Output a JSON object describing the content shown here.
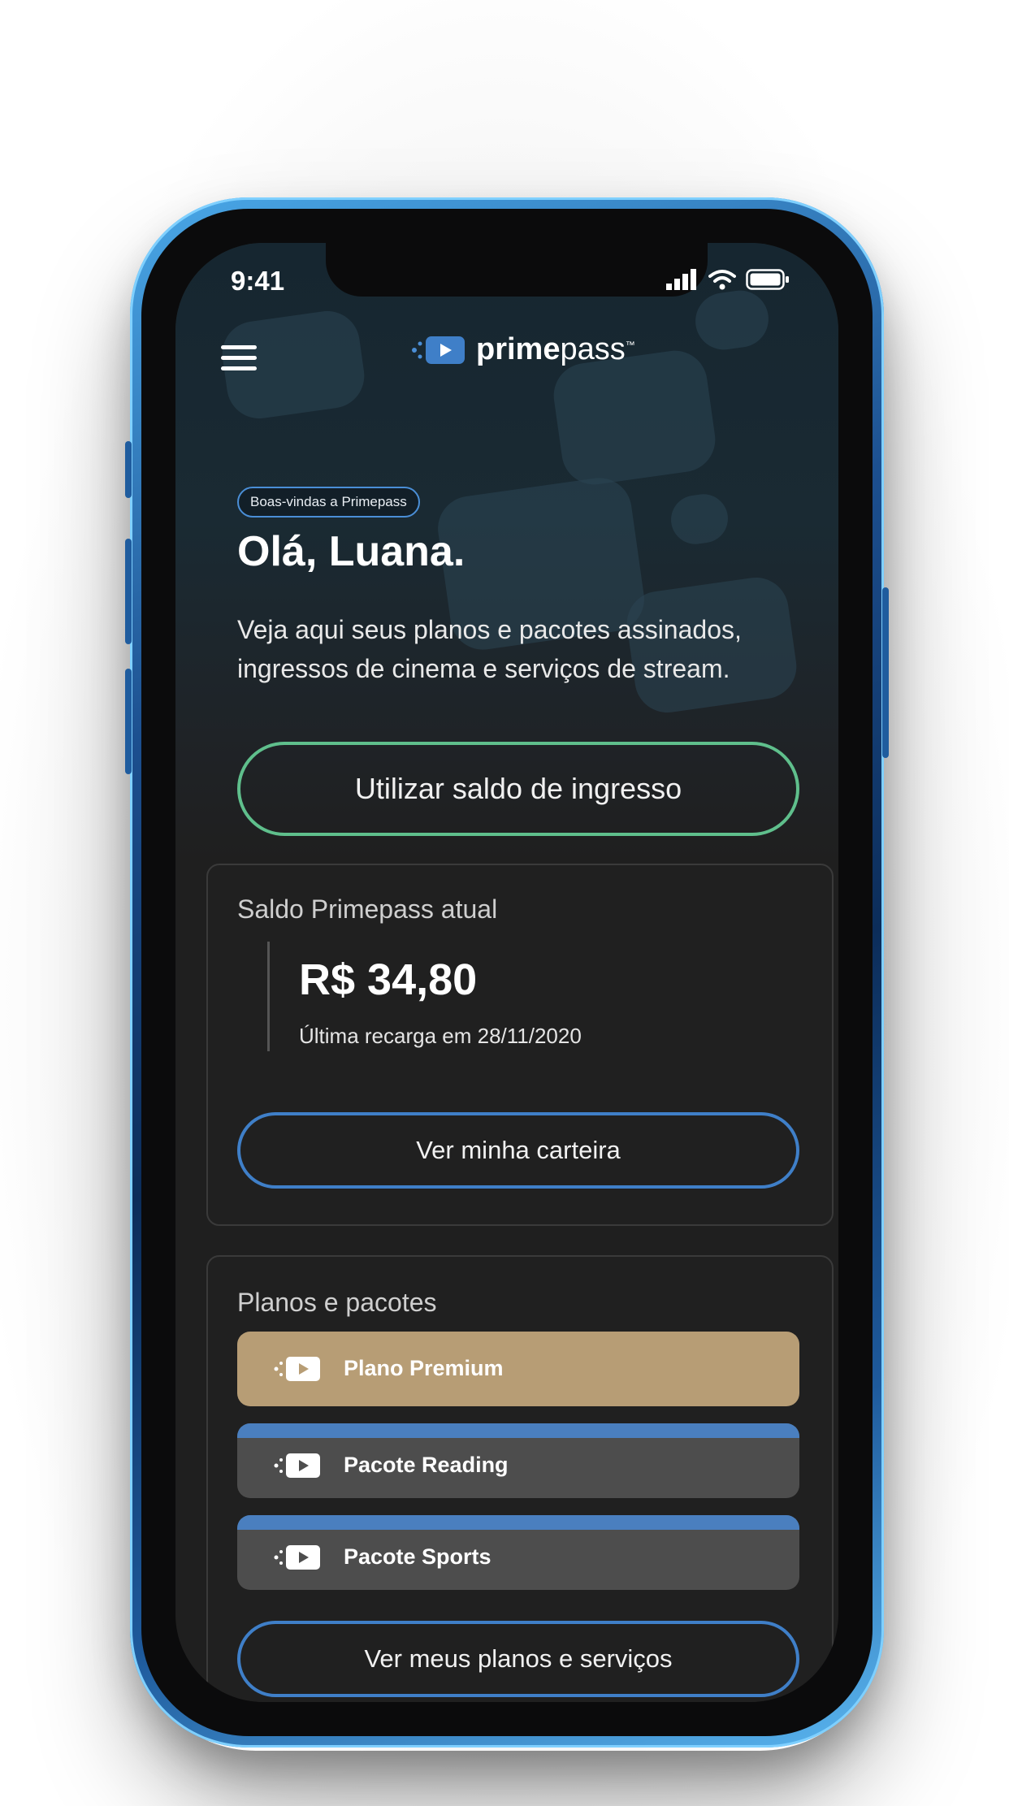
{
  "status_bar": {
    "time": "9:41"
  },
  "header": {
    "logo_bold": "prime",
    "logo_light": "pass",
    "logo_tm": "™"
  },
  "hero": {
    "badge": "Boas-vindas a Primepass",
    "greeting": "Olá, Luana.",
    "intro": "Veja aqui seus planos e pacotes assinados, ingressos de cinema e serviços de stream.",
    "cta": "Utilizar saldo de ingresso"
  },
  "balance_card": {
    "title": "Saldo Primepass atual",
    "amount": "R$ 34,80",
    "last_recharge": "Última recarga em 28/11/2020",
    "button": "Ver minha carteira"
  },
  "plans_card": {
    "title": "Planos e pacotes",
    "items": [
      {
        "label": "Plano Premium",
        "color": "#b79d75"
      },
      {
        "label": "Pacote Reading",
        "color": "#4d4d4d",
        "accent": "#4a7fbf"
      },
      {
        "label": "Pacote Sports",
        "color": "#4d4d4d",
        "accent": "#4a7fbf"
      }
    ],
    "button": "Ver meus planos e serviços"
  },
  "colors": {
    "brand_blue": "#3f7fc8",
    "cta_green": "#5fbf8c",
    "premium_gold": "#b79d75",
    "background": "#1f1f1f"
  },
  "icons": [
    "menu-icon",
    "play-ticket-icon",
    "signal-icon",
    "wifi-icon",
    "battery-icon"
  ]
}
